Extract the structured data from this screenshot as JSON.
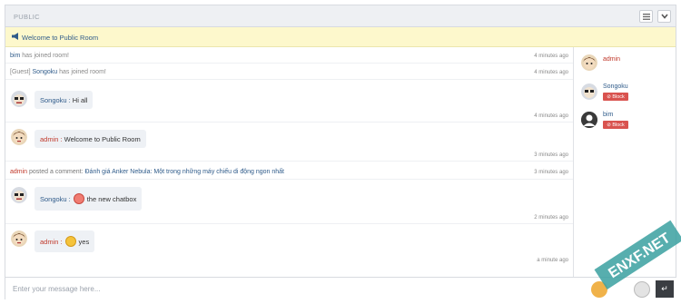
{
  "header": {
    "title": "PUBLIC",
    "menu_icon": "list-icon",
    "collapse_icon": "chevron-down-icon"
  },
  "notice": {
    "icon": "megaphone-icon",
    "text": "Welcome to Public Room"
  },
  "system_messages": [
    {
      "user": "bim",
      "text": " has joined room!",
      "time": "4 minutes ago"
    },
    {
      "prefix": "[Guest] ",
      "user": "Songoku",
      "text": " has joined room!",
      "time": "4 minutes ago"
    }
  ],
  "messages": [
    {
      "user": "Songoku",
      "sep": ":",
      "text": "Hi all",
      "time": "4 minutes ago",
      "avatar": "songoku-avatar"
    },
    {
      "user": "admin",
      "sep": ":",
      "text": "Welcome to Public Room",
      "time": "3 minutes ago",
      "avatar": "admin-avatar"
    },
    {
      "user": "Songoku",
      "sep": ":",
      "text": "the new chatbox",
      "time": "2 minutes ago",
      "avatar": "songoku-avatar",
      "emoji": "face-emoji"
    },
    {
      "user": "admin",
      "sep": ":",
      "text": "yes",
      "time": "a minute ago",
      "avatar": "admin-avatar",
      "emoji": "star-eyes-emoji"
    }
  ],
  "comment": {
    "user": "admin",
    "action": " posted a comment: ",
    "link": "Đánh giá Anker Nebula: Một trong những máy chiếu di động ngon nhất",
    "time": "3 minutes ago"
  },
  "users": [
    {
      "name": "admin",
      "color": "#c0392b"
    },
    {
      "name": "Songoku",
      "color": "#2f5b8a",
      "block": "Block"
    },
    {
      "name": "bim",
      "color": "#2f5b8a",
      "block": "Block"
    }
  ],
  "footer": {
    "placeholder": "Enter your message here...",
    "send_icon": "enter-icon"
  },
  "watermark": {
    "text": "ENXF.NET"
  },
  "colors": {
    "accent_blue": "#2f5b8a",
    "admin_red": "#c0392b",
    "block_red": "#d9534f",
    "notice_bg": "#fdf8cc"
  }
}
